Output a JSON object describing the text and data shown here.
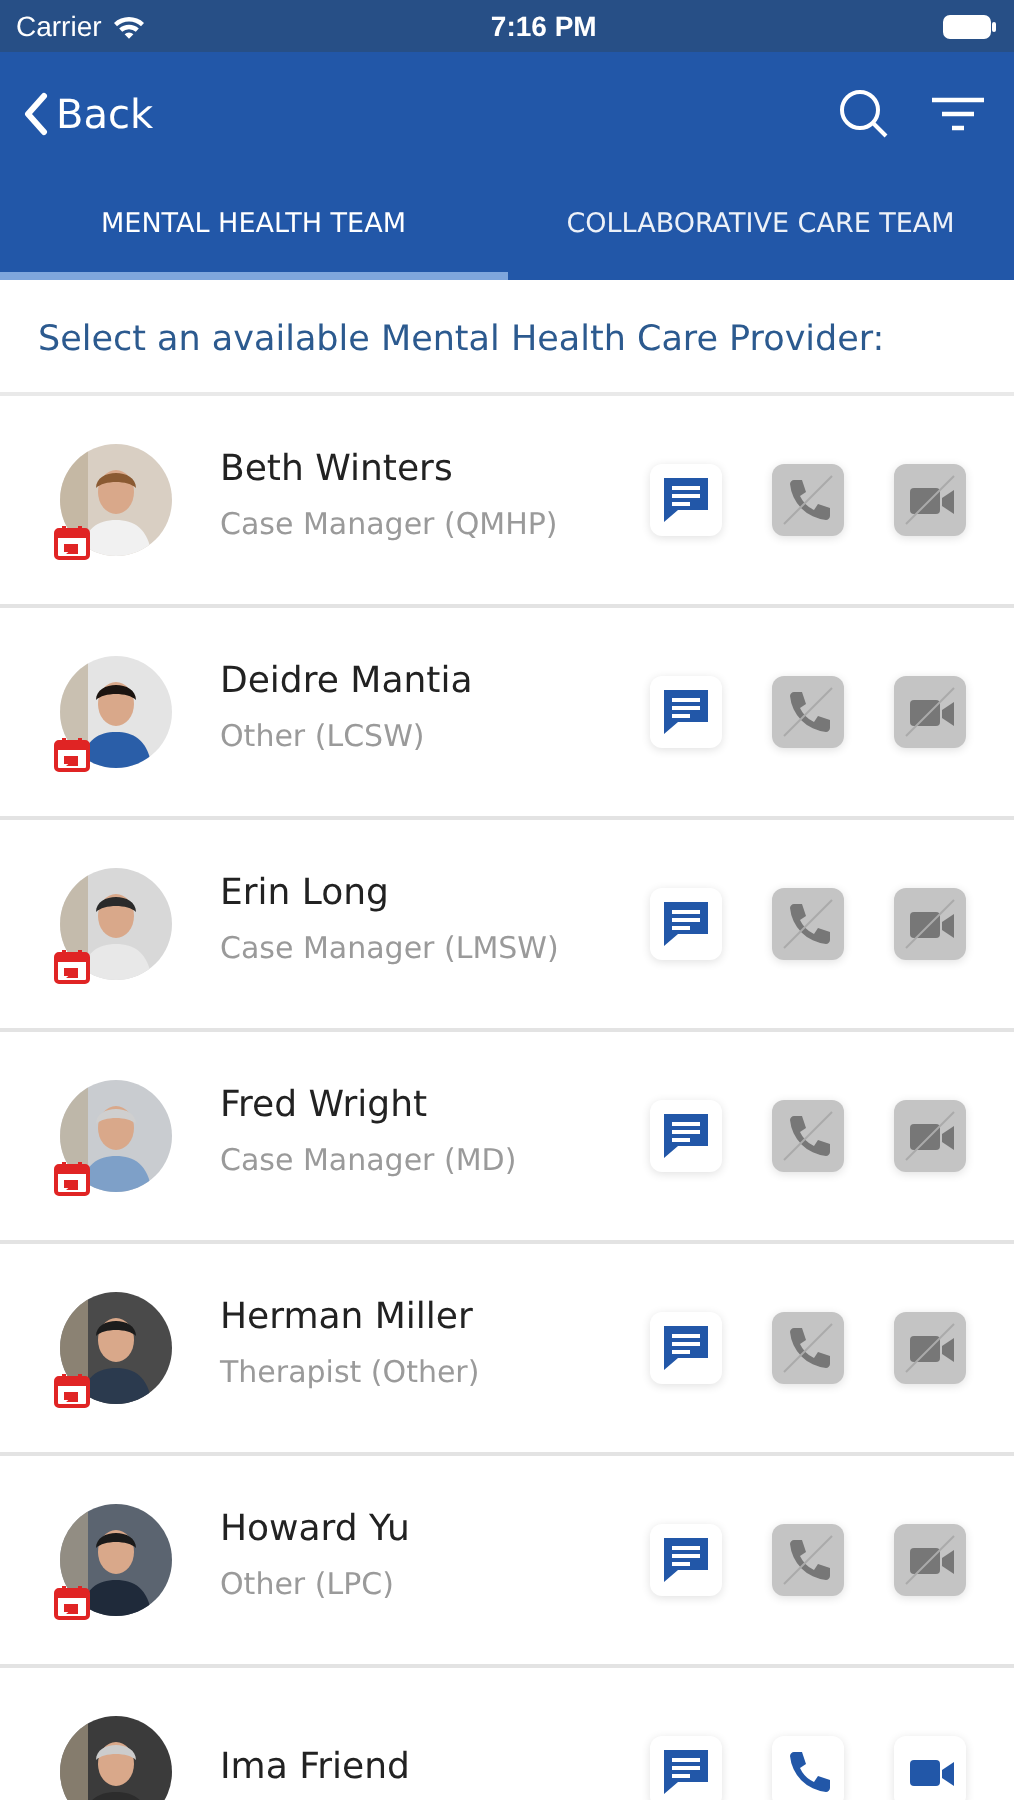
{
  "status_bar": {
    "carrier": "Carrier",
    "time": "7:16 PM"
  },
  "nav": {
    "back": "Back"
  },
  "tabs": [
    {
      "label": "MENTAL HEALTH TEAM",
      "selected": true
    },
    {
      "label": "COLLABORATIVE CARE TEAM",
      "selected": false
    }
  ],
  "heading": "Select an available Mental Health Care Provider:",
  "providers": [
    {
      "name": "Beth Winters",
      "role": "Case Manager (QMHP)",
      "calendar_badge": true,
      "chat_enabled": true,
      "call_enabled": false,
      "video_enabled": false
    },
    {
      "name": "Deidre Mantia",
      "role": "Other (LCSW)",
      "calendar_badge": true,
      "chat_enabled": true,
      "call_enabled": false,
      "video_enabled": false
    },
    {
      "name": "Erin Long",
      "role": "Case Manager (LMSW)",
      "calendar_badge": true,
      "chat_enabled": true,
      "call_enabled": false,
      "video_enabled": false
    },
    {
      "name": "Fred Wright",
      "role": "Case Manager (MD)",
      "calendar_badge": true,
      "chat_enabled": true,
      "call_enabled": false,
      "video_enabled": false
    },
    {
      "name": "Herman Miller",
      "role": "Therapist (Other)",
      "calendar_badge": true,
      "chat_enabled": true,
      "call_enabled": false,
      "video_enabled": false
    },
    {
      "name": "Howard Yu",
      "role": "Other (LPC)",
      "calendar_badge": true,
      "chat_enabled": true,
      "call_enabled": false,
      "video_enabled": false
    },
    {
      "name": "Ima Friend",
      "calendar_badge": false,
      "chat_enabled": true,
      "call_enabled": true,
      "video_enabled": true
    }
  ]
}
